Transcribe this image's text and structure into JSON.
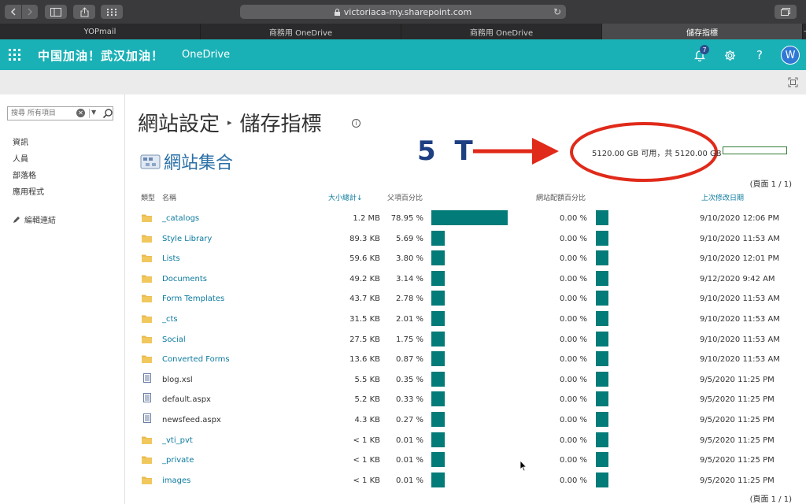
{
  "browser": {
    "url": "victoriaca-my.sharepoint.com",
    "tabs": [
      {
        "label": "YOPmail",
        "active": false
      },
      {
        "label": "商務用 OneDrive",
        "active": false
      },
      {
        "label": "商務用 OneDrive",
        "active": false
      },
      {
        "label": "儲存指標",
        "active": true
      }
    ],
    "new_tab": "+"
  },
  "suite": {
    "brand_title": "中国加油！武汉加油！",
    "app_name": "OneDrive",
    "notification_count": "7",
    "help": "?",
    "avatar_initial": "W",
    "bar_color": "#1ab1b6"
  },
  "leftnav": {
    "search_placeholder": "搜尋 所有項目",
    "items": [
      "資訊",
      "人員",
      "部落格",
      "應用程式"
    ],
    "edit_links": "編輯連結"
  },
  "page": {
    "breadcrumb_parent": "網站設定",
    "breadcrumb_current": "儲存指標",
    "info": "i",
    "site_collection": "網站集合",
    "annotation": "5 T",
    "quota_text": "5120.00 GB 可用，共 5120.00 GB",
    "paging": "(頁面 1 / 1)"
  },
  "table": {
    "headers": {
      "type": "類型",
      "name": "名稱",
      "total_size": "大小總計↓",
      "parent_pct": "父項百分比",
      "quota_pct": "網站配額百分比",
      "last_modified": "上次修改日期"
    },
    "rows": [
      {
        "type": "folder",
        "name": "_catalogs",
        "size": "1.2 MB",
        "parent_pct": "78.95 %",
        "parent_frac": 0.7895,
        "quota_pct": "0.00 %",
        "modified": "9/10/2020 12:06 PM"
      },
      {
        "type": "folder",
        "name": "Style Library",
        "size": "89.3 KB",
        "parent_pct": "5.69 %",
        "parent_frac": 0.0569,
        "quota_pct": "0.00 %",
        "modified": "9/10/2020 11:53 AM"
      },
      {
        "type": "folder",
        "name": "Lists",
        "size": "59.6 KB",
        "parent_pct": "3.80 %",
        "parent_frac": 0.038,
        "quota_pct": "0.00 %",
        "modified": "9/10/2020 12:01 PM"
      },
      {
        "type": "folder",
        "name": "Documents",
        "size": "49.2 KB",
        "parent_pct": "3.14 %",
        "parent_frac": 0.0314,
        "quota_pct": "0.00 %",
        "modified": "9/12/2020 9:42 AM"
      },
      {
        "type": "folder",
        "name": "Form Templates",
        "size": "43.7 KB",
        "parent_pct": "2.78 %",
        "parent_frac": 0.0278,
        "quota_pct": "0.00 %",
        "modified": "9/10/2020 11:53 AM"
      },
      {
        "type": "folder",
        "name": "_cts",
        "size": "31.5 KB",
        "parent_pct": "2.01 %",
        "parent_frac": 0.0201,
        "quota_pct": "0.00 %",
        "modified": "9/10/2020 11:53 AM"
      },
      {
        "type": "folder",
        "name": "Social",
        "size": "27.5 KB",
        "parent_pct": "1.75 %",
        "parent_frac": 0.0175,
        "quota_pct": "0.00 %",
        "modified": "9/10/2020 11:53 AM"
      },
      {
        "type": "folder",
        "name": "Converted Forms",
        "size": "13.6 KB",
        "parent_pct": "0.87 %",
        "parent_frac": 0.0087,
        "quota_pct": "0.00 %",
        "modified": "9/10/2020 11:53 AM"
      },
      {
        "type": "file",
        "name": "blog.xsl",
        "size": "5.5 KB",
        "parent_pct": "0.35 %",
        "parent_frac": 0.0035,
        "quota_pct": "0.00 %",
        "modified": "9/5/2020 11:25 PM"
      },
      {
        "type": "file",
        "name": "default.aspx",
        "size": "5.2 KB",
        "parent_pct": "0.33 %",
        "parent_frac": 0.0033,
        "quota_pct": "0.00 %",
        "modified": "9/5/2020 11:25 PM"
      },
      {
        "type": "file",
        "name": "newsfeed.aspx",
        "size": "4.3 KB",
        "parent_pct": "0.27 %",
        "parent_frac": 0.0027,
        "quota_pct": "0.00 %",
        "modified": "9/5/2020 11:25 PM"
      },
      {
        "type": "folder",
        "name": "_vti_pvt",
        "size": "< 1 KB",
        "parent_pct": "0.01 %",
        "parent_frac": 0.0001,
        "quota_pct": "0.00 %",
        "modified": "9/5/2020 11:25 PM"
      },
      {
        "type": "folder",
        "name": "_private",
        "size": "< 1 KB",
        "parent_pct": "0.01 %",
        "parent_frac": 0.0001,
        "quota_pct": "0.00 %",
        "modified": "9/5/2020 11:25 PM"
      },
      {
        "type": "folder",
        "name": "images",
        "size": "< 1 KB",
        "parent_pct": "0.01 %",
        "parent_frac": 0.0001,
        "quota_pct": "0.00 %",
        "modified": "9/5/2020 11:25 PM"
      }
    ]
  },
  "colors": {
    "bar": "#037b78",
    "link": "#0b7a9e",
    "annotation_red": "#e02a1a",
    "annotation_blue": "#1e3f82"
  }
}
